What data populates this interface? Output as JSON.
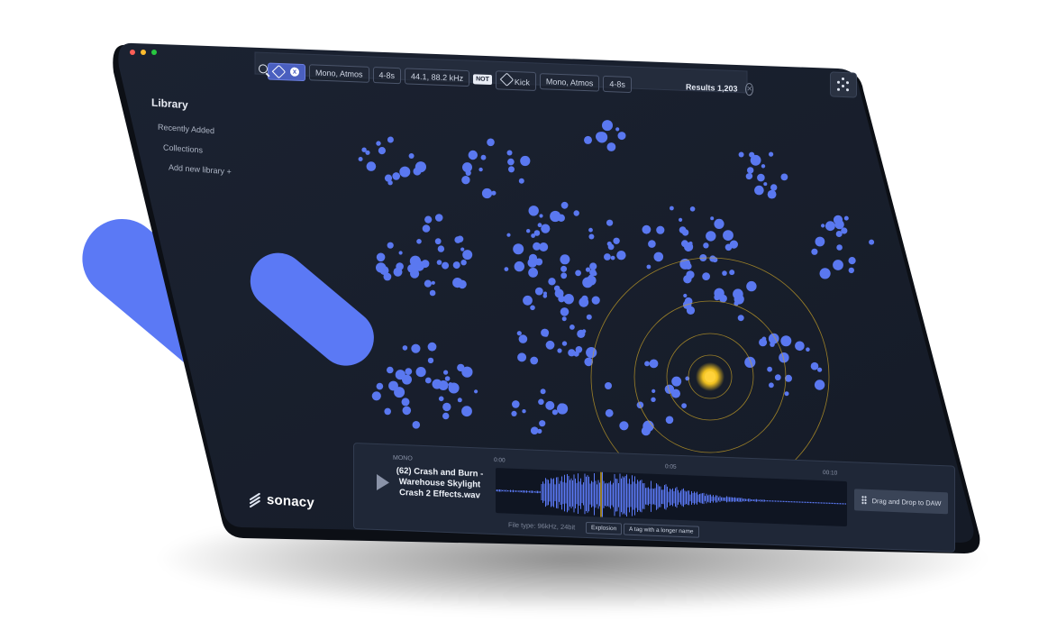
{
  "colors": {
    "accent": "#5b79f5",
    "dot": "#5a78f0",
    "highlight": "#f2c21f",
    "surface": "#1a2130"
  },
  "search": {
    "icon": "search-icon",
    "filters": [
      {
        "type": "active",
        "label": "x",
        "icon": "tag-icon"
      },
      {
        "type": "chip",
        "label": "Mono, Atmos"
      },
      {
        "type": "chip",
        "label": "4-8s"
      },
      {
        "type": "chip",
        "label": "44.1, 88.2 kHz"
      }
    ],
    "not_label": "NOT",
    "exclude_filters": [
      {
        "label": "Kick",
        "icon": "tag-icon"
      },
      {
        "label": "Mono, Atmos"
      },
      {
        "label": "4-8s"
      }
    ],
    "results_label": "Results 1,203"
  },
  "sidebar": {
    "title": "Library",
    "items": [
      "Recently Added",
      "Collections",
      "Add new library +"
    ]
  },
  "brand": {
    "name": "sonacy"
  },
  "player": {
    "channel": "MONO",
    "track_title": "(62) Crash and Burn - Warehouse Skylight Crash 2 Effects.wav",
    "times": [
      "0:00",
      "0:05",
      "00:10"
    ],
    "playhead": 0.3,
    "file_type": "File type: 96kHz, 24bit",
    "tags": [
      "Explosion",
      "A tag with a longer name"
    ],
    "drag_label": "Drag and Drop to DAW"
  }
}
